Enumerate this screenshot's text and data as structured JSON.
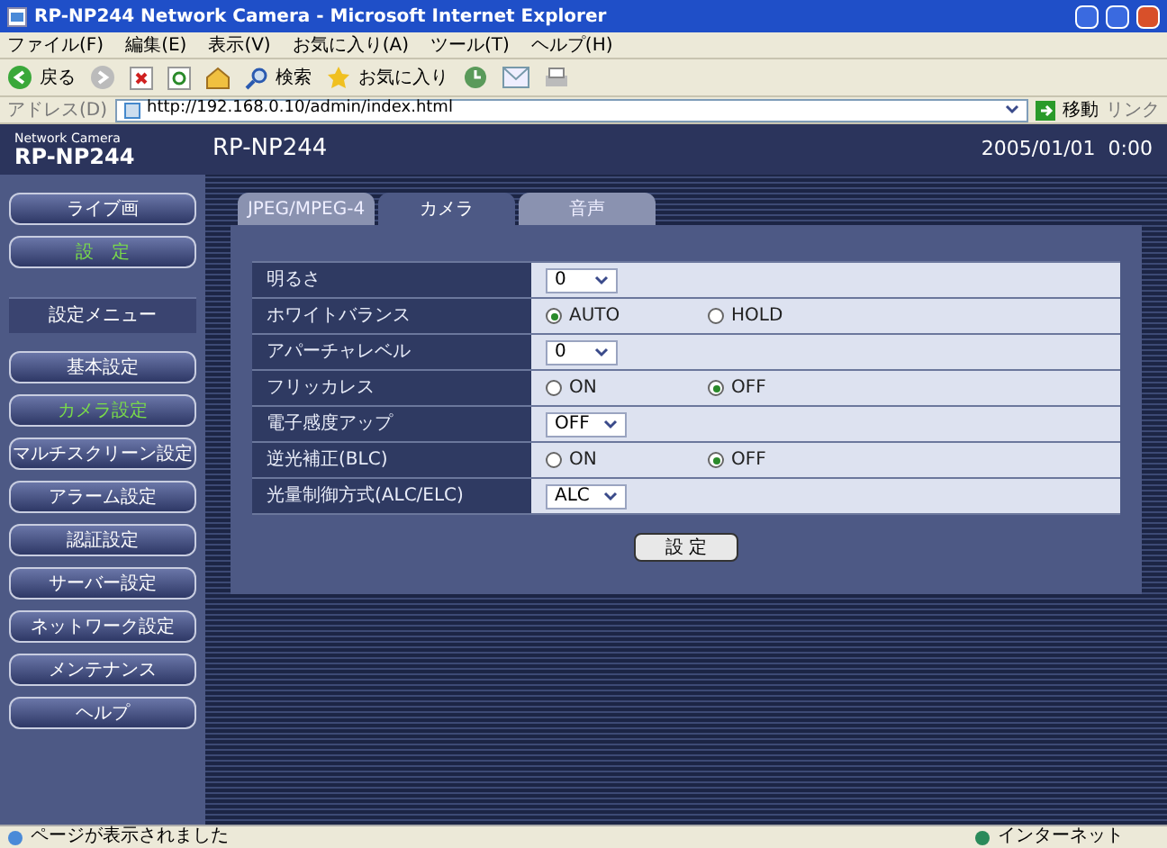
{
  "window": {
    "title": "RP-NP244 Network Camera - Microsoft Internet Explorer"
  },
  "menu": [
    "ファイル(F)",
    "編集(E)",
    "表示(V)",
    "お気に入り(A)",
    "ツール(T)",
    "ヘルプ(H)"
  ],
  "toolbar": {
    "back": "戻る",
    "search": "検索",
    "favorites": "お気に入り"
  },
  "address": {
    "label": "アドレス(D)",
    "url": "http://192.168.0.10/admin/index.html",
    "go": "移動",
    "links": "リンク"
  },
  "header": {
    "product_caption": "Network Camera",
    "product": "RP-NP244",
    "title": "RP-NP244",
    "datetime": "2005/01/01  0:00"
  },
  "sidebar": [
    {
      "kind": "button",
      "label": "ライブ画",
      "selected": false
    },
    {
      "kind": "button",
      "label": "設　定",
      "selected": true
    },
    {
      "kind": "heading",
      "label": "設定メニュー"
    },
    {
      "kind": "button",
      "label": "基本設定",
      "selected": false
    },
    {
      "kind": "button",
      "label": "カメラ設定",
      "selected": true
    },
    {
      "kind": "button",
      "label": "マルチスクリーン設定",
      "selected": false
    },
    {
      "kind": "button",
      "label": "アラーム設定",
      "selected": false
    },
    {
      "kind": "button",
      "label": "認証設定",
      "selected": false
    },
    {
      "kind": "button",
      "label": "サーバー設定",
      "selected": false
    },
    {
      "kind": "button",
      "label": "ネットワーク設定",
      "selected": false
    },
    {
      "kind": "button",
      "label": "メンテナンス",
      "selected": false
    },
    {
      "kind": "button",
      "label": "ヘルプ",
      "selected": false
    }
  ],
  "tabs": [
    {
      "label": "JPEG/MPEG-4",
      "selected": false
    },
    {
      "label": "カメラ",
      "selected": true
    },
    {
      "label": "音声",
      "selected": false
    }
  ],
  "settings": [
    {
      "label": "明るさ",
      "kind": "select",
      "value": "0"
    },
    {
      "label": "ホワイトバランス",
      "kind": "radio",
      "options": [
        {
          "label": "AUTO",
          "selected": true
        },
        {
          "label": "HOLD",
          "selected": false
        }
      ]
    },
    {
      "label": "アパーチャレベル",
      "kind": "select",
      "value": "0"
    },
    {
      "label": "フリッカレス",
      "kind": "radio",
      "options": [
        {
          "label": "ON",
          "selected": false
        },
        {
          "label": "OFF",
          "selected": true
        }
      ]
    },
    {
      "label": "電子感度アップ",
      "kind": "select",
      "value": "OFF"
    },
    {
      "label": "逆光補正(BLC)",
      "kind": "radio",
      "options": [
        {
          "label": "ON",
          "selected": false
        },
        {
          "label": "OFF",
          "selected": true
        }
      ]
    },
    {
      "label": "光量制御方式(ALC/ELC)",
      "kind": "select",
      "value": "ALC"
    }
  ],
  "submit": "設 定",
  "status_bar": {
    "message": "ページが表示されました",
    "zone": "インターネット"
  }
}
